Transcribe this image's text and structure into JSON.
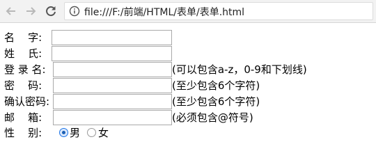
{
  "browser": {
    "url": "file:///F:/前端/HTML/表单/表单.html"
  },
  "form": {
    "rows": [
      {
        "label": "名    字:",
        "value": "",
        "hint": ""
      },
      {
        "label": "姓    氏:",
        "value": "",
        "hint": ""
      },
      {
        "label": "登 录 名:",
        "value": "",
        "hint": "(可以包含a-z，0-9和下划线)"
      },
      {
        "label": "密    码:",
        "value": "",
        "hint": "(至少包含6个字符)"
      },
      {
        "label": "确认密码:",
        "value": "",
        "hint": "(至少包含6个字符)"
      },
      {
        "label": "邮    箱:",
        "value": "",
        "hint": "(必须包含@符号)"
      }
    ],
    "gender": {
      "label": "性    别:",
      "options": [
        {
          "label": "男",
          "checked": true
        },
        {
          "label": "女",
          "checked": false
        }
      ]
    }
  }
}
